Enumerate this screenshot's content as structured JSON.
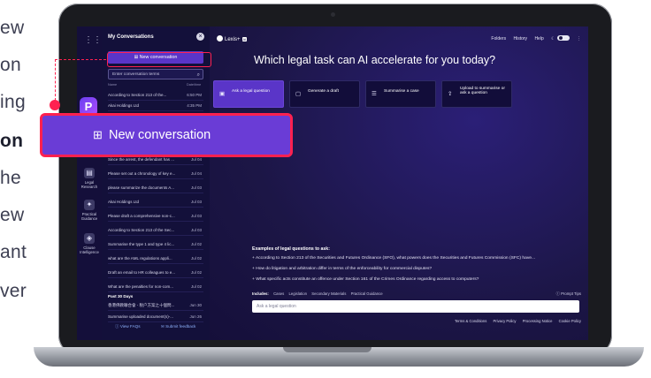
{
  "background_text": {
    "lines": [
      "ew",
      "on",
      "ing",
      "on",
      "he",
      "ew",
      "ant",
      "ver"
    ],
    "bold_line_index": 3
  },
  "rail": {
    "brand_letter": "P",
    "items": [
      {
        "icon": "legal-research-icon",
        "label": "Legal Research"
      },
      {
        "icon": "practical-guidance-icon",
        "label": "Practical Guidance"
      },
      {
        "icon": "clause-intelligence-icon",
        "label": "Clause Intelligence"
      }
    ]
  },
  "panel": {
    "title": "My Conversations",
    "new_conversation_label": "New conversation",
    "search_placeholder": "Enter conversation terms",
    "col_name": "Name",
    "col_date": "Date/time",
    "today_rows": [
      {
        "title": "According to Section 213 of the...",
        "date": "6:50 PM"
      },
      {
        "title": "Akai Holdings Ltd",
        "date": "4:35 PM"
      }
    ],
    "section_7": "Past 7 Days",
    "week_rows": [
      {
        "title": "Since the arrest, the defendant has ...",
        "date": "Jul 04"
      },
      {
        "title": "Please set out a chronology of key e...",
        "date": "Jul 04"
      },
      {
        "title": "please summarize the documents A...",
        "date": "Jul 03"
      },
      {
        "title": "Akai Holdings Ltd",
        "date": "Jul 03"
      },
      {
        "title": "Please draft a comprehensive non-c...",
        "date": "Jul 03"
      },
      {
        "title": "According to Section 213 of the Sec...",
        "date": "Jul 03"
      },
      {
        "title": "Summarise the type 1 and type 4 lic...",
        "date": "Jul 02"
      },
      {
        "title": "what are the AML regulations appli...",
        "date": "Jul 02"
      },
      {
        "title": "Draft an email to HR colleagues to e...",
        "date": "Jul 02"
      },
      {
        "title": "What are the penalties for non-com...",
        "date": "Jul 02"
      }
    ],
    "section_30": "Past 30 Days",
    "month_rows": [
      {
        "title": "香港佛教聯合會 - 稅户方案之十個問...",
        "date": "Jun 30"
      },
      {
        "title": "Summarise uploaded document(s)-...",
        "date": "Jun 26"
      }
    ],
    "view_faqs": "View FAQs",
    "submit_feedback": "Submit feedback"
  },
  "header": {
    "logo": "Lexis+",
    "logo_badge": "AI",
    "nav": [
      "Folders",
      "History",
      "Help"
    ]
  },
  "main": {
    "headline": "Which legal task can AI accelerate for you today?",
    "cards": [
      {
        "label": "Ask a legal question",
        "icon": "chat-icon",
        "active": true
      },
      {
        "label": "Generate a draft",
        "icon": "draft-icon",
        "active": false
      },
      {
        "label": "Summarise a case",
        "icon": "list-icon",
        "active": false
      },
      {
        "label": "Upload to summarise or ask a question",
        "icon": "upload-icon",
        "active": false
      }
    ],
    "examples_title": "Examples of legal questions to ask:",
    "examples": [
      "According to Section 213 of the Securities and Futures Ordinance (SFO), what powers does the Securities and Futures Commission (SFC) have...",
      "How do litigation and arbitration differ in terms of the enforceability for commercial disputes?",
      "What specific acts constitute an offence under Section 161 of the Crimes Ordinance regarding access to computers?"
    ],
    "includes_label": "Includes:",
    "includes": [
      "Cases",
      "Legislation",
      "Secondary Materials",
      "Practical Guidance"
    ],
    "prompt_tips": "Prompt Tips",
    "ask_placeholder": "Ask a legal question",
    "footer_links": [
      "Terms & Conditions",
      "Privacy Policy",
      "Processing Notice",
      "Cookie Policy"
    ]
  },
  "callout": {
    "label": "New conversation"
  },
  "colors": {
    "accent": "#5a35c8",
    "highlight": "#ff2150",
    "panel_bg": "#13103a"
  }
}
